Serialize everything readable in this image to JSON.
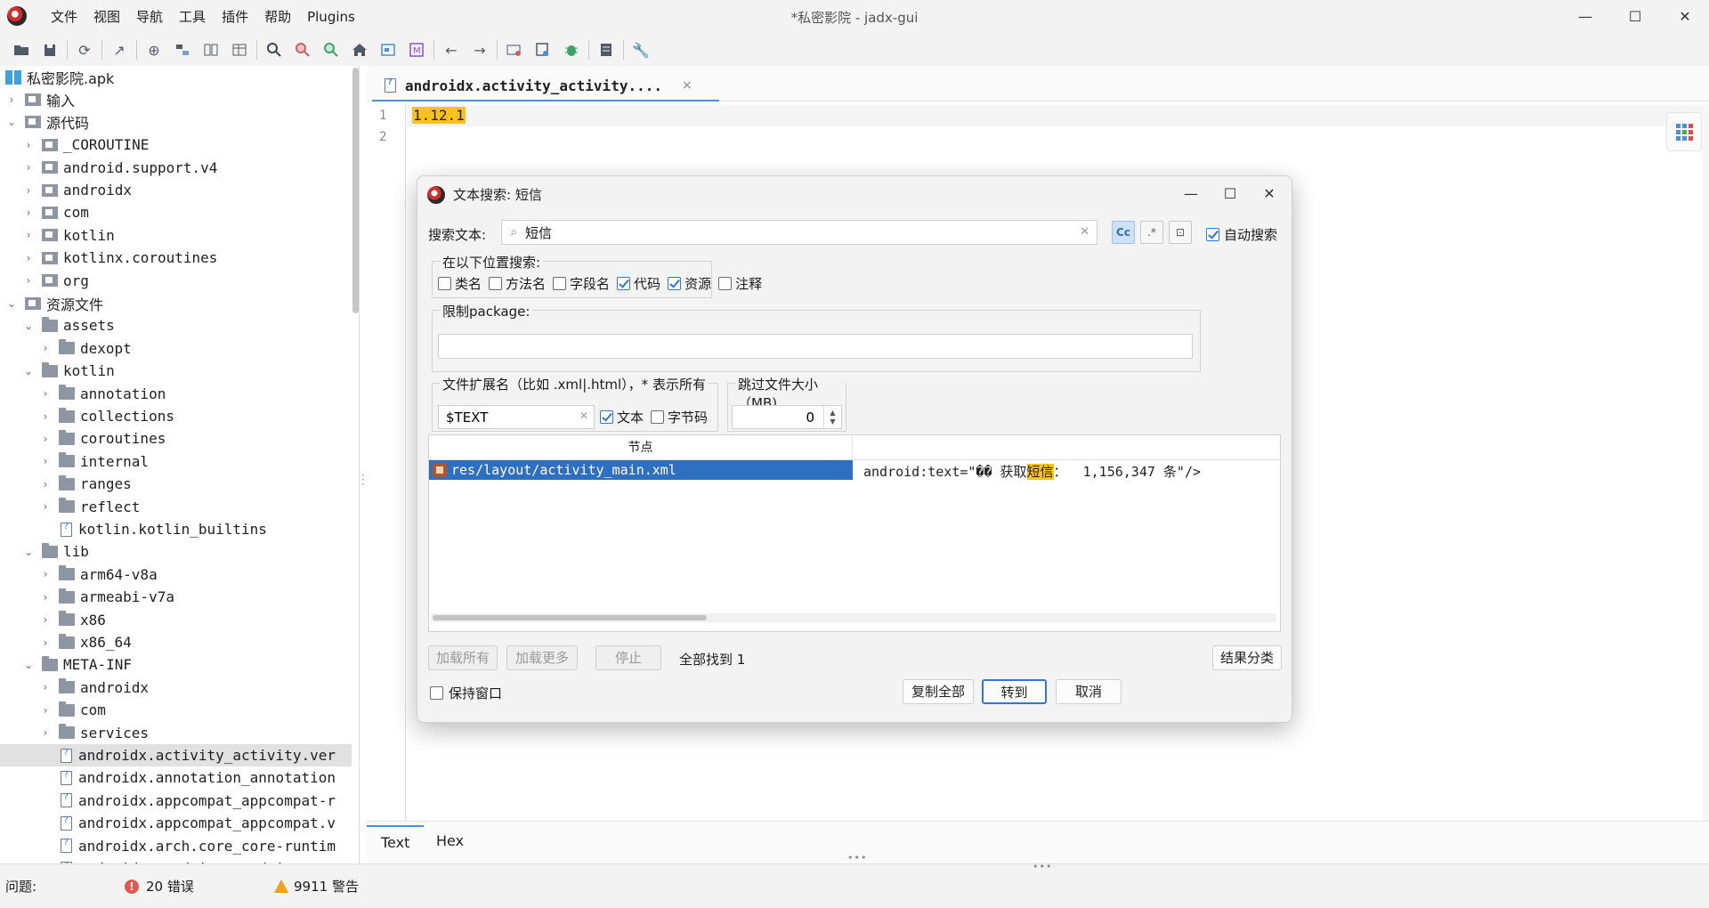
{
  "app": {
    "window_title": "*私密影院 - jadx-gui",
    "menu": [
      "文件",
      "视图",
      "导航",
      "工具",
      "插件",
      "帮助",
      "Plugins"
    ],
    "win_controls": {
      "minimize": "—",
      "maximize": "☐",
      "close": "✕"
    }
  },
  "toolbar": {
    "icons": [
      "open-file-icon",
      "save-all-icon",
      "sync-icon",
      "export-icon",
      "deobfuscate-icon",
      "class-tree-icon",
      "split-view-icon",
      "table-icon",
      "search-icon",
      "search-class-icon",
      "search-usage-icon",
      "home-icon",
      "frame-icon",
      "m-icon",
      "back-icon",
      "forward-icon",
      "settings-app-icon",
      "bookmark-icon",
      "debug-icon",
      "log-icon",
      "wrench-icon"
    ]
  },
  "tree": {
    "items": [
      {
        "label": "私密影院.apk",
        "depth": 0,
        "chev": "",
        "icon": "apk",
        "cjk": true
      },
      {
        "label": "输入",
        "depth": 0,
        "chev": "›",
        "icon": "pkg",
        "cjk": true
      },
      {
        "label": "源代码",
        "depth": 0,
        "chev": "⌄",
        "icon": "pkg",
        "cjk": true
      },
      {
        "label": "_COROUTINE",
        "depth": 1,
        "chev": "›",
        "icon": "pkg"
      },
      {
        "label": "android.support.v4",
        "depth": 1,
        "chev": "›",
        "icon": "pkg"
      },
      {
        "label": "androidx",
        "depth": 1,
        "chev": "›",
        "icon": "pkg"
      },
      {
        "label": "com",
        "depth": 1,
        "chev": "›",
        "icon": "pkg"
      },
      {
        "label": "kotlin",
        "depth": 1,
        "chev": "›",
        "icon": "pkg"
      },
      {
        "label": "kotlinx.coroutines",
        "depth": 1,
        "chev": "›",
        "icon": "pkg"
      },
      {
        "label": "org",
        "depth": 1,
        "chev": "›",
        "icon": "pkg"
      },
      {
        "label": "资源文件",
        "depth": 0,
        "chev": "⌄",
        "icon": "pkg",
        "cjk": true
      },
      {
        "label": "assets",
        "depth": 1,
        "chev": "⌄",
        "icon": "folder"
      },
      {
        "label": "dexopt",
        "depth": 2,
        "chev": "›",
        "icon": "folder"
      },
      {
        "label": "kotlin",
        "depth": 1,
        "chev": "⌄",
        "icon": "folder"
      },
      {
        "label": "annotation",
        "depth": 2,
        "chev": "›",
        "icon": "folder"
      },
      {
        "label": "collections",
        "depth": 2,
        "chev": "›",
        "icon": "folder"
      },
      {
        "label": "coroutines",
        "depth": 2,
        "chev": "›",
        "icon": "folder"
      },
      {
        "label": "internal",
        "depth": 2,
        "chev": "›",
        "icon": "folder"
      },
      {
        "label": "ranges",
        "depth": 2,
        "chev": "›",
        "icon": "folder"
      },
      {
        "label": "reflect",
        "depth": 2,
        "chev": "›",
        "icon": "folder"
      },
      {
        "label": "kotlin.kotlin_builtins",
        "depth": 2,
        "chev": "",
        "icon": "file"
      },
      {
        "label": "lib",
        "depth": 1,
        "chev": "⌄",
        "icon": "folder"
      },
      {
        "label": "arm64-v8a",
        "depth": 2,
        "chev": "›",
        "icon": "folder"
      },
      {
        "label": "armeabi-v7a",
        "depth": 2,
        "chev": "›",
        "icon": "folder"
      },
      {
        "label": "x86",
        "depth": 2,
        "chev": "›",
        "icon": "folder"
      },
      {
        "label": "x86_64",
        "depth": 2,
        "chev": "›",
        "icon": "folder"
      },
      {
        "label": "META-INF",
        "depth": 1,
        "chev": "⌄",
        "icon": "folder"
      },
      {
        "label": "androidx",
        "depth": 2,
        "chev": "›",
        "icon": "folder"
      },
      {
        "label": "com",
        "depth": 2,
        "chev": "›",
        "icon": "folder"
      },
      {
        "label": "services",
        "depth": 2,
        "chev": "›",
        "icon": "folder"
      },
      {
        "label": "androidx.activity_activity.ver",
        "depth": 2,
        "chev": "",
        "icon": "file",
        "selected": true
      },
      {
        "label": "androidx.annotation_annotation",
        "depth": 2,
        "chev": "",
        "icon": "file"
      },
      {
        "label": "androidx.appcompat_appcompat-r",
        "depth": 2,
        "chev": "",
        "icon": "file"
      },
      {
        "label": "androidx.appcompat_appcompat.v",
        "depth": 2,
        "chev": "",
        "icon": "file"
      },
      {
        "label": "androidx.arch.core_core-runtim",
        "depth": 2,
        "chev": "",
        "icon": "file"
      },
      {
        "label": "androidx.cardview_cardview.ver",
        "depth": 2,
        "chev": "",
        "icon": "file"
      }
    ]
  },
  "editor": {
    "tab_label": "androidx.activity_activity....",
    "tab_close": "×",
    "line_numbers": [
      "1",
      "2"
    ],
    "line1": "1.12.1",
    "bottom_tabs": {
      "text": "Text",
      "hex": "Hex"
    }
  },
  "status": {
    "problems": "问题:",
    "errors": "20 错误",
    "warnings": "9911 警告",
    "error_glyph": "!",
    "colors": {
      "error": "#e05a4f",
      "warning": "#f0a020"
    }
  },
  "dialog": {
    "title": "文本搜索: 短信",
    "search_label": "搜索文本:",
    "search_value": "短信",
    "opt_case": "Cc",
    "opt_regex": ".*",
    "opt_whole": "⊡",
    "auto_search": "自动搜索",
    "scope_title": "在以下位置搜索:",
    "scope": [
      {
        "label": "类名",
        "checked": false
      },
      {
        "label": "方法名",
        "checked": false
      },
      {
        "label": "字段名",
        "checked": false
      },
      {
        "label": "代码",
        "checked": true
      },
      {
        "label": "资源",
        "checked": true
      },
      {
        "label": "注释",
        "checked": false
      }
    ],
    "pkg_title": "限制package:",
    "pkg_value": "",
    "ext_title": "文件扩展名（比如 .xml|.html），* 表示所有",
    "ext_value": "$TEXT",
    "ext_opts": [
      {
        "label": "文本",
        "checked": true
      },
      {
        "label": "字节码",
        "checked": false
      }
    ],
    "size_title": "跳过文件大小（MB)",
    "size_value": "0",
    "results": {
      "col_node": "节点",
      "row_node": "res/layout/activity_main.xml",
      "row_code_pre": "android:text=\"�� 获取",
      "row_code_hl": "短信",
      "row_code_post": "：  1,156,347 条\"/>"
    },
    "btn_load_all": "加载所有",
    "btn_load_more": "加载更多",
    "btn_stop": "停止",
    "found": "全部找到 1",
    "btn_classify": "结果分类",
    "keep_window": "保持窗口",
    "btn_copy_all": "复制全部",
    "btn_goto": "转到",
    "btn_cancel": "取消"
  }
}
